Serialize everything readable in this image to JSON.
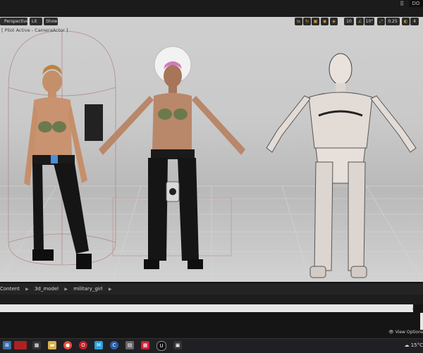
{
  "window": {
    "top_label": "DO"
  },
  "viewport": {
    "buttons": {
      "perspective": "Perspective",
      "lit": "Lit",
      "show": "Show"
    },
    "pilot_text": "[ Pilot Active - CameraActor ]",
    "snap_values": {
      "grid": "10",
      "angle": "10°",
      "scale": "0.25",
      "camera_speed": "4"
    }
  },
  "content_browser": {
    "breadcrumbs": [
      "Content",
      "3d_model",
      "military_girl"
    ],
    "search_placeholder": "",
    "view_options": "View Options"
  },
  "taskbar": {
    "weather": "15°C"
  },
  "colors": {
    "accent": "#e0a030",
    "viewport_bg": "#c9c9c9",
    "panel_bg": "#242424"
  }
}
